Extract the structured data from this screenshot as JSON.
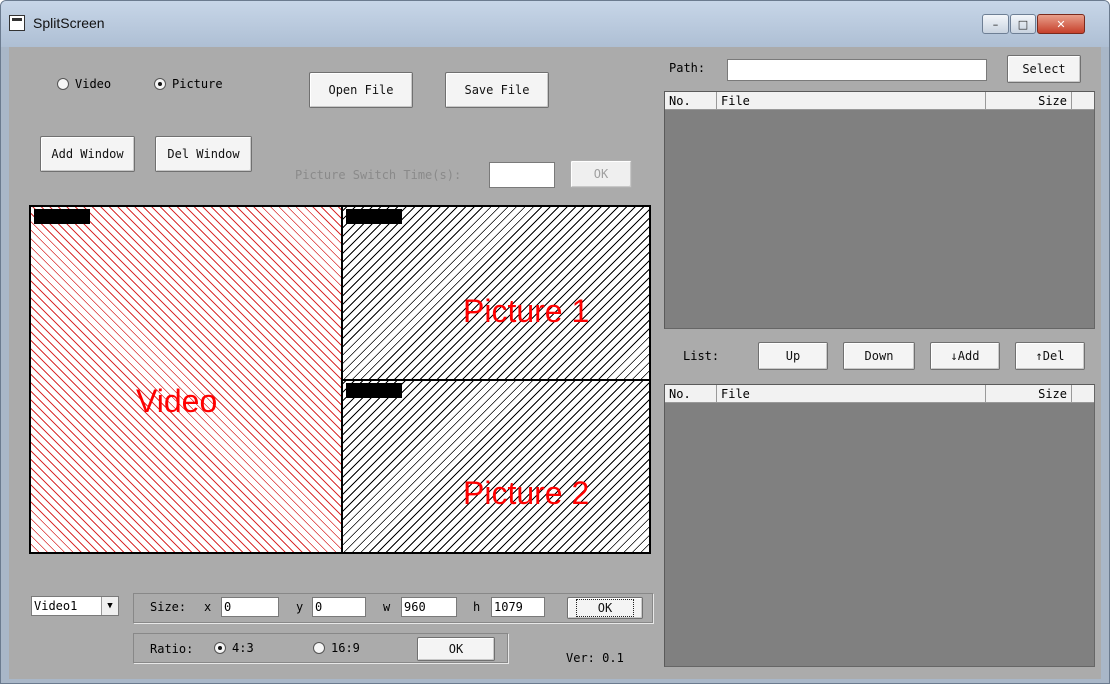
{
  "window": {
    "title": "SplitScreen",
    "controls": {
      "minimize": "–",
      "maximize": "□",
      "close": "✕"
    }
  },
  "mode": {
    "video_label": "Video",
    "picture_label": "Picture",
    "selected": "Picture"
  },
  "buttons": {
    "open_file": "Open File",
    "save_file": "Save File",
    "add_window": "Add Window",
    "del_window": "Del Window",
    "switch_ok": "OK",
    "size_ok": "OK",
    "ratio_ok": "OK"
  },
  "picture_switch": {
    "label": "Picture Switch Time(s):",
    "value": "",
    "enabled": false
  },
  "canvas": {
    "regions": [
      {
        "label": "Video",
        "color": "#d93030"
      },
      {
        "label": "Picture 1",
        "color": "#000000"
      },
      {
        "label": "Picture 2",
        "color": "#000000"
      }
    ]
  },
  "window_select": {
    "value": "Video1"
  },
  "size": {
    "label": "Size:",
    "x_label": "x",
    "x": "0",
    "y_label": "y",
    "y": "0",
    "w_label": "w",
    "w": "960",
    "h_label": "h",
    "h": "1079"
  },
  "ratio": {
    "label": "Ratio:",
    "option_a": "4:3",
    "option_b": "16:9",
    "selected": "4:3"
  },
  "version": "Ver: 0.1",
  "path": {
    "label": "Path:",
    "value": "",
    "select_button": "Select"
  },
  "file_table": {
    "columns": [
      "No.",
      "File",
      "Size"
    ],
    "rows": []
  },
  "list": {
    "label": "List:",
    "up": "Up",
    "down": "Down",
    "add": "↓Add",
    "del": "↑Del",
    "columns": [
      "No.",
      "File",
      "Size"
    ],
    "rows": []
  }
}
